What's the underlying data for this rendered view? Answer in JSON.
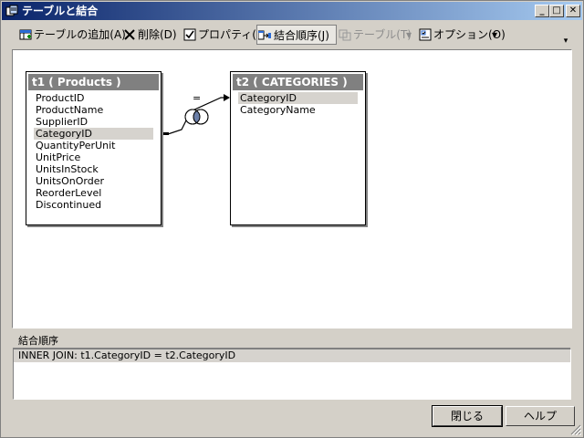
{
  "window": {
    "title": "テーブルと結合",
    "minimize": "_",
    "maximize": "□",
    "close": "✕"
  },
  "toolbar": {
    "add_table": "テーブルの追加(A)",
    "delete": "削除(D)",
    "properties": "プロパティ(P)",
    "join_order": "結合順序(J)",
    "table": "テーブル(T)",
    "options": "オプション(O)",
    "dropdown_arrow": "▾",
    "overflow": "▾"
  },
  "tables": [
    {
      "title": "t1 ( Products )",
      "columns": [
        "ProductID",
        "ProductName",
        "SupplierID",
        "CategoryID",
        "QuantityPerUnit",
        "UnitPrice",
        "UnitsInStock",
        "UnitsOnOrder",
        "ReorderLevel",
        "Discontinued"
      ],
      "selected_index": 3
    },
    {
      "title": "t2 ( CATEGORIES )",
      "columns": [
        "CategoryID",
        "CategoryName"
      ],
      "selected_index": 0
    }
  ],
  "join": {
    "operator": "="
  },
  "join_order": {
    "label": "結合順序",
    "rows": [
      "INNER JOIN: t1.CategoryID = t2.CategoryID"
    ]
  },
  "buttons": {
    "close": "閉じる",
    "help": "ヘルプ"
  },
  "colors": {
    "title_start": "#0a246a",
    "title_end": "#a6caf0",
    "header_bg": "#808080",
    "selection_bg": "#d6d3ce"
  }
}
